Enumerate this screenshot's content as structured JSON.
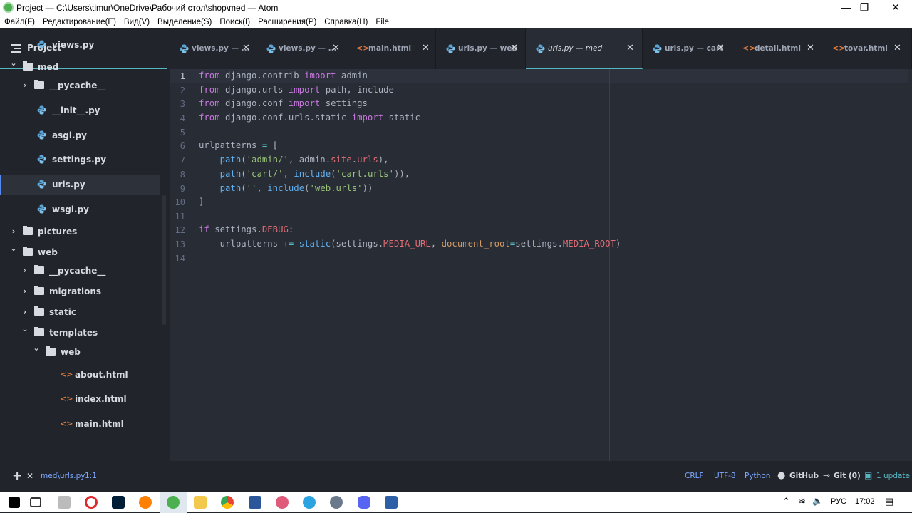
{
  "window": {
    "title": "Project — C:\\Users\\timur\\OneDrive\\Рабочий стол\\shop\\med — Atom",
    "minimize": "—",
    "maximize": "❐",
    "close": "✕"
  },
  "menu": [
    "Файл(F)",
    "Редактирование(E)",
    "Вид(V)",
    "Выделение(S)",
    "Поиск(I)",
    "Расширения(P)",
    "Справка(H)",
    "File"
  ],
  "sidebar": {
    "title": "Project",
    "items": [
      {
        "name": "views.py",
        "kind": "py"
      },
      {
        "name": "med",
        "kind": "folder-open"
      },
      {
        "name": "__pycache__",
        "kind": "folder"
      },
      {
        "name": "__init__.py",
        "kind": "py"
      },
      {
        "name": "asgi.py",
        "kind": "py"
      },
      {
        "name": "settings.py",
        "kind": "py"
      },
      {
        "name": "urls.py",
        "kind": "py"
      },
      {
        "name": "wsgi.py",
        "kind": "py"
      },
      {
        "name": "pictures",
        "kind": "folder"
      },
      {
        "name": "web",
        "kind": "folder-open"
      },
      {
        "name": "__pycache__",
        "kind": "folder"
      },
      {
        "name": "migrations",
        "kind": "folder"
      },
      {
        "name": "static",
        "kind": "folder"
      },
      {
        "name": "templates",
        "kind": "folder-open"
      },
      {
        "name": "web",
        "kind": "folder-open"
      },
      {
        "name": "about.html",
        "kind": "html"
      },
      {
        "name": "index.html",
        "kind": "html"
      },
      {
        "name": "main.html",
        "kind": "html"
      }
    ]
  },
  "tabs": [
    {
      "label": "views.py — ...",
      "kind": "py"
    },
    {
      "label": "views.py — ...",
      "kind": "py"
    },
    {
      "label": "main.html",
      "kind": "html"
    },
    {
      "label": "urls.py — web",
      "kind": "py"
    },
    {
      "label": "urls.py — med",
      "kind": "py"
    },
    {
      "label": "urls.py — cart",
      "kind": "py"
    },
    {
      "label": "detail.html",
      "kind": "html"
    },
    {
      "label": "tovar.html",
      "kind": "html"
    }
  ],
  "tab_close": "✕",
  "editor": {
    "line_numbers": [
      "1",
      "2",
      "3",
      "4",
      "5",
      "6",
      "7",
      "8",
      "9",
      "10",
      "11",
      "12",
      "13",
      "14"
    ]
  },
  "status": {
    "file": "med\\urls.py",
    "position": "1:1",
    "line_ending": "CRLF",
    "encoding": "UTF-8",
    "grammar": "Python",
    "github": "GitHub",
    "git": "Git (0)",
    "updates": "1 update",
    "add": "+",
    "close": "✕"
  },
  "taskbar": {
    "lang": "РУС",
    "time": "17:02"
  },
  "colors": {
    "accent": "#56b6c2",
    "keyword": "#c678dd",
    "string": "#98c379",
    "function": "#61afef",
    "property": "#e06c75"
  }
}
